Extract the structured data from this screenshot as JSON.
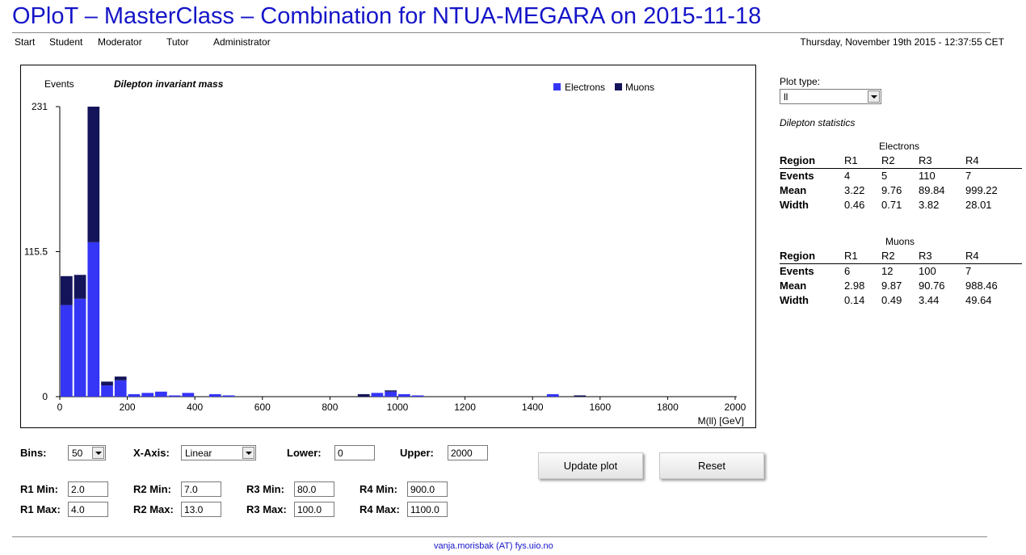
{
  "header": {
    "title": "OPloT – MasterClass – Combination for NTUA-MEGARA on 2015-11-18",
    "datetime": "Thursday, November 19th 2015 - 12:37:55 CET"
  },
  "nav": {
    "start": "Start",
    "student": "Student",
    "moderator": "Moderator",
    "tutor": "Tutor",
    "administrator": "Administrator"
  },
  "colors": {
    "title": "#1515c8",
    "electrons": "#3535f5",
    "muons": "#14145a"
  },
  "chart_data": {
    "type": "bar",
    "stacked": true,
    "title": "Dilepton invariant mass",
    "xlabel": "M(ll) [GeV]",
    "ylabel": "Events",
    "xlim": [
      0,
      2000
    ],
    "ylim": [
      0,
      231
    ],
    "yticks": [
      "0",
      "115.5",
      "231"
    ],
    "xticks": [
      "0",
      "200",
      "400",
      "600",
      "800",
      "1000",
      "1200",
      "1400",
      "1600",
      "1800",
      "2000"
    ],
    "legend_position": "top-right",
    "bin_width": 40,
    "bin_starts": [
      0,
      40,
      80,
      120,
      160,
      200,
      240,
      280,
      320,
      360,
      400,
      440,
      480,
      880,
      920,
      960,
      1000,
      1040,
      1440,
      1520
    ],
    "series": [
      {
        "name": "Electrons",
        "values": [
          73,
          78,
          123,
          9,
          13,
          2,
          3,
          4,
          1,
          3,
          0,
          2,
          1,
          0,
          3,
          4,
          2,
          1,
          2,
          0
        ]
      },
      {
        "name": "Muons",
        "values": [
          23,
          19,
          108,
          3,
          3,
          0,
          0,
          0,
          0,
          0,
          0,
          0,
          0,
          2,
          0,
          1,
          0,
          0,
          0,
          1
        ]
      }
    ]
  },
  "sidebar": {
    "plot_type_label": "Plot type:",
    "plot_type_value": "ll",
    "stats_title": "Dilepton statistics"
  },
  "electrons": {
    "title": "Electrons",
    "header": [
      "Region",
      "R1",
      "R2",
      "R3",
      "R4"
    ],
    "rows": [
      [
        "Events",
        "4",
        "5",
        "110",
        "7"
      ],
      [
        "Mean",
        "3.22",
        "9.76",
        "89.84",
        "999.22"
      ],
      [
        "Width",
        "0.46",
        "0.71",
        "3.82",
        "28.01"
      ]
    ]
  },
  "muons": {
    "title": "Muons",
    "header": [
      "Region",
      "R1",
      "R2",
      "R3",
      "R4"
    ],
    "rows": [
      [
        "Events",
        "6",
        "12",
        "100",
        "7"
      ],
      [
        "Mean",
        "2.98",
        "9.87",
        "90.76",
        "988.46"
      ],
      [
        "Width",
        "0.14",
        "0.49",
        "3.44",
        "49.64"
      ]
    ]
  },
  "controls": {
    "bins_label": "Bins:",
    "bins_value": "50",
    "xaxis_label": "X-Axis:",
    "xaxis_value": "Linear",
    "lower_label": "Lower:",
    "lower_value": "0",
    "upper_label": "Upper:",
    "upper_value": "2000",
    "update_button": "Update plot",
    "reset_button": "Reset",
    "r1min_label": "R1 Min:",
    "r1min_value": "2.0",
    "r2min_label": "R2 Min:",
    "r2min_value": "7.0",
    "r3min_label": "R3 Min:",
    "r3min_value": "80.0",
    "r4min_label": "R4 Min:",
    "r4min_value": "900.0",
    "r1max_label": "R1 Max:",
    "r1max_value": "4.0",
    "r2max_label": "R2 Max:",
    "r2max_value": "13.0",
    "r3max_label": "R3 Max:",
    "r3max_value": "100.0",
    "r4max_label": "R4 Max:",
    "r4max_value": "1100.0"
  },
  "footer": {
    "email": "vanja.morisbak (AT) fys.uio.no"
  }
}
